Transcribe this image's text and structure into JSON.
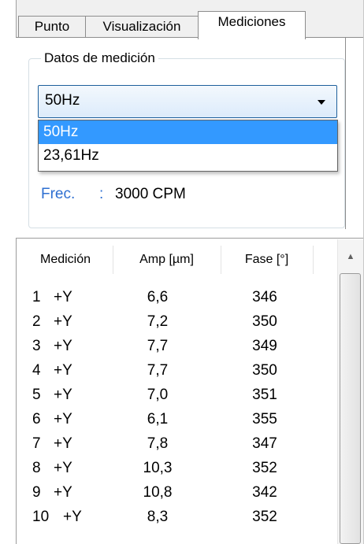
{
  "tabs": [
    {
      "label": "Punto"
    },
    {
      "label": "Visualización"
    },
    {
      "label": "Mediciones",
      "active": true
    }
  ],
  "group": {
    "title": "Datos de medición"
  },
  "combo": {
    "value": "50Hz"
  },
  "dropdown": {
    "options": [
      {
        "label": "50Hz",
        "selected": true
      },
      {
        "label": "23,61Hz",
        "selected": false
      }
    ]
  },
  "frequency": {
    "label": "Frec.",
    "separator": ":",
    "value": "3000 CPM"
  },
  "table": {
    "headers": [
      "Medición",
      "Amp [µm]",
      "Fase [°]"
    ],
    "rows": [
      {
        "num": "1",
        "axis": "+Y",
        "amp": "6,6",
        "phase": "346"
      },
      {
        "num": "2",
        "axis": "+Y",
        "amp": "7,2",
        "phase": "350"
      },
      {
        "num": "3",
        "axis": "+Y",
        "amp": "7,7",
        "phase": "349"
      },
      {
        "num": "4",
        "axis": "+Y",
        "amp": "7,7",
        "phase": "350"
      },
      {
        "num": "5",
        "axis": "+Y",
        "amp": "7,0",
        "phase": "351"
      },
      {
        "num": "6",
        "axis": "+Y",
        "amp": "6,1",
        "phase": "355"
      },
      {
        "num": "7",
        "axis": "+Y",
        "amp": "7,8",
        "phase": "347"
      },
      {
        "num": "8",
        "axis": "+Y",
        "amp": "10,3",
        "phase": "352"
      },
      {
        "num": "9",
        "axis": "+Y",
        "amp": "10,8",
        "phase": "342"
      },
      {
        "num": "10",
        "axis": "+Y",
        "amp": "8,3",
        "phase": "352"
      }
    ]
  },
  "scrollbar": {
    "up_icon": "arrow-up-icon"
  },
  "colors": {
    "selection": "#3399ff",
    "frequency_label": "#2e6fd1",
    "combo_border": "#1e5f9b"
  }
}
